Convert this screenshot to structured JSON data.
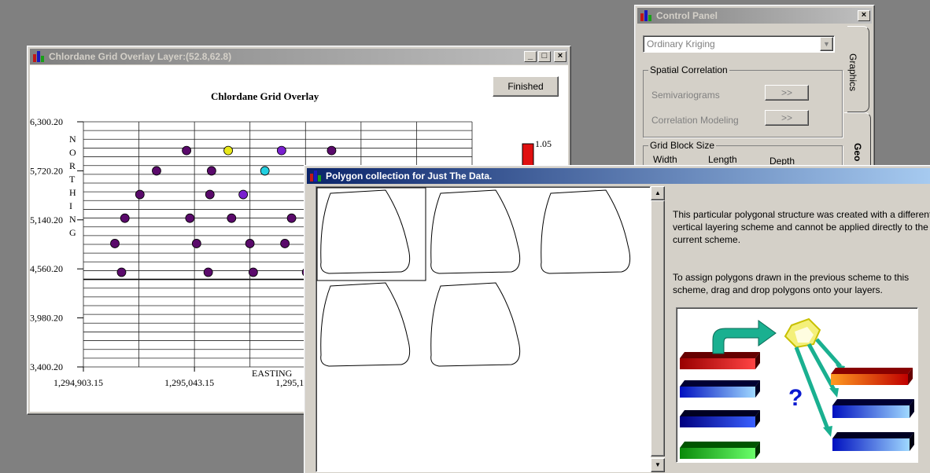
{
  "chart_window": {
    "title": "Chlordane Grid Overlay Layer:(52.8,62.8)",
    "finished_label": "Finished",
    "chart_title": "Chlordane Grid Overlay",
    "ylabel_letters": [
      "N",
      "O",
      "R",
      "T",
      "H",
      "I",
      "N",
      "G"
    ],
    "xlabel": "EASTING",
    "legend_value": "1.05",
    "colors": {
      "point": "#5a0a6b",
      "yellow": "#e8e81a",
      "cyan": "#22cfe0",
      "violet": "#7a20d0",
      "legend_bar": "#e01010"
    }
  },
  "chart_data": {
    "type": "scatter",
    "title": "Chlordane Grid Overlay",
    "xlabel": "EASTING",
    "ylabel": "NORTHING",
    "x_ticks": [
      "1,294,903.15",
      "1,295,043.15",
      "1,295,183.15",
      "1,2"
    ],
    "y_ticks": [
      "6,300.20",
      "5,720.20",
      "5,140.20",
      "4,560.20",
      "3,980.20",
      "3,400.20"
    ],
    "xlim": [
      1294903.15,
      1295323.15
    ],
    "ylim": [
      3400.2,
      6300.2
    ],
    "points": [
      {
        "x": 1294943,
        "y": 5960,
        "c": "point"
      },
      {
        "x": 1294968,
        "y": 5960,
        "c": "yellow"
      },
      {
        "x": 1295000,
        "y": 5960,
        "c": "violet"
      },
      {
        "x": 1295030,
        "y": 5960,
        "c": "point"
      },
      {
        "x": 1294925,
        "y": 5720,
        "c": "point"
      },
      {
        "x": 1294958,
        "y": 5720,
        "c": "point"
      },
      {
        "x": 1294990,
        "y": 5720,
        "c": "cyan"
      },
      {
        "x": 1295024,
        "y": 5720,
        "c": "point"
      },
      {
        "x": 1295050,
        "y": 5720,
        "c": "point"
      },
      {
        "x": 1294915,
        "y": 5440,
        "c": "point"
      },
      {
        "x": 1294957,
        "y": 5440,
        "c": "point"
      },
      {
        "x": 1294977,
        "y": 5440,
        "c": "violet"
      },
      {
        "x": 1295020,
        "y": 5440,
        "c": "point"
      },
      {
        "x": 1294906,
        "y": 5160,
        "c": "point"
      },
      {
        "x": 1294945,
        "y": 5160,
        "c": "point"
      },
      {
        "x": 1294970,
        "y": 5160,
        "c": "point"
      },
      {
        "x": 1295006,
        "y": 5160,
        "c": "point"
      },
      {
        "x": 1294900,
        "y": 4860,
        "c": "point"
      },
      {
        "x": 1294949,
        "y": 4860,
        "c": "point"
      },
      {
        "x": 1294981,
        "y": 4860,
        "c": "point"
      },
      {
        "x": 1295002,
        "y": 4860,
        "c": "point"
      },
      {
        "x": 1294904,
        "y": 4520,
        "c": "point"
      },
      {
        "x": 1294956,
        "y": 4520,
        "c": "point"
      },
      {
        "x": 1294983,
        "y": 4520,
        "c": "point"
      },
      {
        "x": 1295015,
        "y": 4520,
        "c": "point"
      }
    ],
    "grid": true
  },
  "control_panel": {
    "title": "Control Panel",
    "method_select": "Ordinary Kriging",
    "spatial_group": "Spatial Correlation",
    "semivariograms": "Semivariograms",
    "correlation_modeling": "Correlation Modeling",
    "btn_arrow": ">>",
    "grid_group": "Grid Block Size",
    "width": "Width",
    "length": "Length",
    "depth": "Depth",
    "tab_graphics": "Graphics",
    "tab_geo": "Geo"
  },
  "polygon_window": {
    "title": "Polygon collection for Just The Data.",
    "info1": "This particular polygonal structure was created with a different vertical layering scheme and cannot be applied directly to the current scheme.",
    "info2": "To assign polygons drawn in the previous scheme to this scheme, drag and drop polygons onto your layers.",
    "qmark": "?"
  }
}
